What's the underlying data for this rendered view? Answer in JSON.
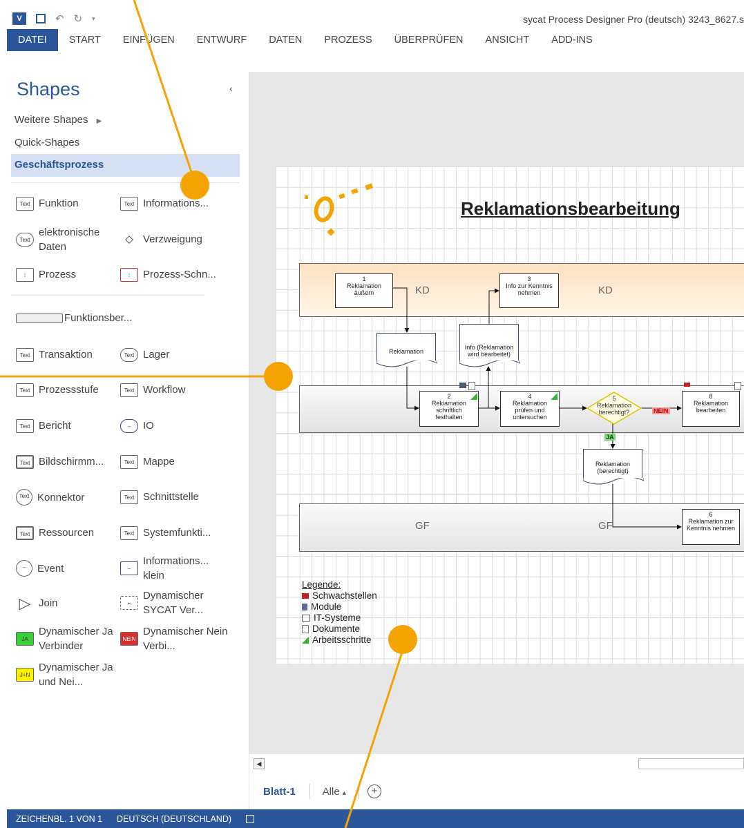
{
  "titlebar": {
    "title": "sycat  Process Designer Pro (deutsch)  3243_8627.s"
  },
  "ribbon": {
    "tabs": [
      "DATEI",
      "START",
      "EINFÜGEN",
      "ENTWURF",
      "DATEN",
      "PROZESS",
      "ÜBERPRÜFEN",
      "ANSICHT",
      "ADD-INS"
    ],
    "active": "DATEI"
  },
  "shapes_pane": {
    "title": "Shapes",
    "links": [
      "Weitere Shapes",
      "Quick-Shapes"
    ],
    "selected_stencil": "Geschäftsprozess",
    "items": {
      "funktion": "Funktion",
      "informations": "Informations...",
      "elektronische_daten": "elektronische Daten",
      "verzweigung": "Verzweigung",
      "prozess": "Prozess",
      "prozess_schn": "Prozess-Schn...",
      "funktionsber": "Funktionsber...",
      "transaktion": "Transaktion",
      "lager": "Lager",
      "prozessstufe": "Prozessstufe",
      "workflow": "Workflow",
      "bericht": "Bericht",
      "io": "IO",
      "bildschirm": "Bildschirmm...",
      "mappe": "Mappe",
      "konnektor": "Konnektor",
      "schnittstelle": "Schnittstelle",
      "ressourcen": "Ressourcen",
      "systemfunkti": "Systemfunkti...",
      "event": "Event",
      "informations_klein": "Informations... klein",
      "join": "Join",
      "dyn_sycat": "Dynamischer SYCAT Ver...",
      "dyn_ja": "Dynamischer Ja Verbinder",
      "dyn_nein": "Dynamischer Nein Verbi...",
      "dyn_janein": "Dynamischer Ja und Nei..."
    },
    "icon_text": "Text"
  },
  "diagram": {
    "title": "Reklamationsbearbeitung",
    "lanes": {
      "kd": "KD",
      "gf": "GF"
    },
    "boxes": {
      "b1": "1\nReklamation\näußern",
      "b3": "3\nInfo zur Kenntnis\nnehmen",
      "b2": "2\nReklamation\nschriftlich\nfesthalten",
      "b4": "4\nReklamation\nprüfen und\nuntersuchen",
      "b5": "5\nReklamation\nberechtigt?",
      "b8": "8\nReklamation\nbearbeiten",
      "b6": "6\nReklamation zur\nKenntnis nehmen"
    },
    "docs": {
      "d1": "Reklamation",
      "d2": "Info (Reklamation\nwird bearbeitet)",
      "d3": "Reklamation\n(berechtigt)"
    },
    "tags": {
      "nein": "NEIN",
      "ja": "JA"
    },
    "legend": {
      "title": "Legende:",
      "items": [
        "Schwachstellen",
        "Module",
        "IT-Systeme",
        "Dokumente",
        "Arbeitsschritte"
      ]
    },
    "colors": {
      "lane_kd": "#fbe1c0",
      "logo": "#f5a300",
      "accent": "#2b579a"
    }
  },
  "sheets": {
    "active": "Blatt-1",
    "all": "Alle",
    "add": "+"
  },
  "statusbar": {
    "page": "ZEICHENBL. 1 VON 1",
    "language": "DEUTSCH (DEUTSCHLAND)"
  }
}
